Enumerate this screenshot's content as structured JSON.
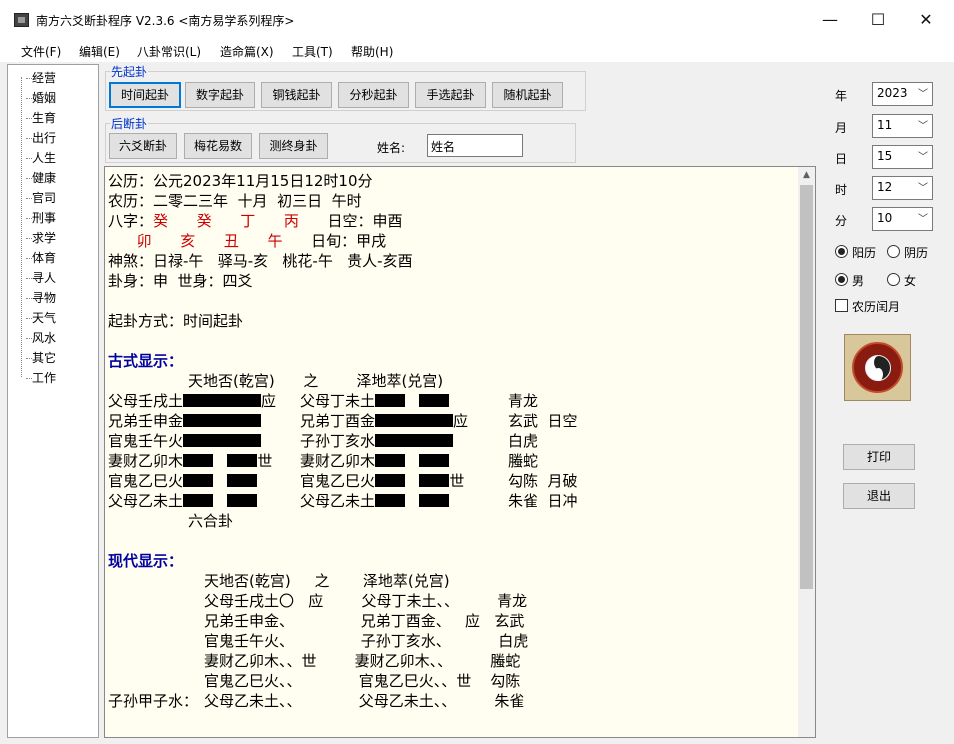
{
  "window": {
    "title": "南方六爻断卦程序 V2.3.6   <南方易学系列程序>",
    "minimize": "—",
    "maximize": "☐",
    "close": "✕"
  },
  "menu": [
    "文件(F)",
    "编辑(E)",
    "八卦常识(L)",
    "造命篇(X)",
    "工具(T)",
    "帮助(H)"
  ],
  "tree": [
    "经营",
    "婚姻",
    "生育",
    "出行",
    "人生",
    "健康",
    "官司",
    "刑事",
    "求学",
    "体育",
    "寻人",
    "寻物",
    "天气",
    "风水",
    "其它",
    "工作"
  ],
  "qigua": {
    "title": "先起卦",
    "buttons": [
      "时间起卦",
      "数字起卦",
      "铜钱起卦",
      "分秒起卦",
      "手选起卦",
      "随机起卦"
    ]
  },
  "duangua": {
    "title": "后断卦",
    "buttons": [
      "六爻断卦",
      "梅花易数",
      "测终身卦"
    ],
    "name_label": "姓名:",
    "name_value": "姓名"
  },
  "content": {
    "line1": "公历：公元2023年11月15日12时10分",
    "line2": "农历：二零二三年  十月  初三日  午时",
    "bazi_label": "八字：",
    "gan": [
      "癸",
      "癸",
      "丁",
      "丙"
    ],
    "zhi": [
      "卯",
      "亥",
      "丑",
      "午"
    ],
    "rikong": "日空：申酉",
    "rixun": "日旬：甲戌",
    "shensha": "神煞：日禄-午   驿马-亥   桃花-午   贵人-亥酉",
    "guashen": "卦身：申  世身：四爻",
    "method": "起卦方式：时间起卦",
    "gushi_head": "古式显示：",
    "gushi_title": "天地否(乾宫)      之        泽地萃(兑宫)",
    "gushi_lines": [
      {
        "a": "父母壬戌土",
        "m1": "应",
        "b": "父母丁未土",
        "m2": "",
        "g": "青龙"
      },
      {
        "a": "兄弟壬申金",
        "m1": "",
        "b": "兄弟丁酉金",
        "m2": "应",
        "g": "玄武  日空"
      },
      {
        "a": "官鬼壬午火",
        "m1": "",
        "b": "子孙丁亥水",
        "m2": "",
        "g": "白虎"
      },
      {
        "a": "妻财乙卯木",
        "m1": "世",
        "b": "妻财乙卯木",
        "m2": "",
        "g": "螣蛇"
      },
      {
        "a": "官鬼乙巳火",
        "m1": "",
        "b": "官鬼乙巳火",
        "m2": "世",
        "g": "勾陈  月破"
      },
      {
        "a": "父母乙未土",
        "m1": "",
        "b": "父母乙未土",
        "m2": "",
        "g": "朱雀  日冲"
      }
    ],
    "liuhe": "六合卦",
    "xiandai_head": "现代显示：",
    "xiandai_title": "天地否(乾宫)     之       泽地萃(兑宫)",
    "xiandai_lines": [
      "父母壬戌土〇   应        父母丁未土、、        青龙",
      "兄弟壬申金、              兄弟丁酉金、   应   玄武",
      "官鬼壬午火、              子孙丁亥水、          白虎",
      "妻财乙卯木、、世        妻财乙卯木、、        螣蛇",
      "官鬼乙巳火、、            官鬼乙巳火、、世    勾陈",
      "父母乙未土、、            父母乙未土、、        朱雀"
    ],
    "fushen": "子孙甲子水："
  },
  "right": {
    "year_label": "年",
    "year": "2023",
    "month_label": "月",
    "month": "11",
    "day_label": "日",
    "day": "15",
    "hour_label": "时",
    "hour": "12",
    "minute_label": "分",
    "minute": "10",
    "solar": "阳历",
    "lunar": "阴历",
    "male": "男",
    "female": "女",
    "leap": "农历闰月",
    "print": "打印",
    "exit": "退出"
  }
}
